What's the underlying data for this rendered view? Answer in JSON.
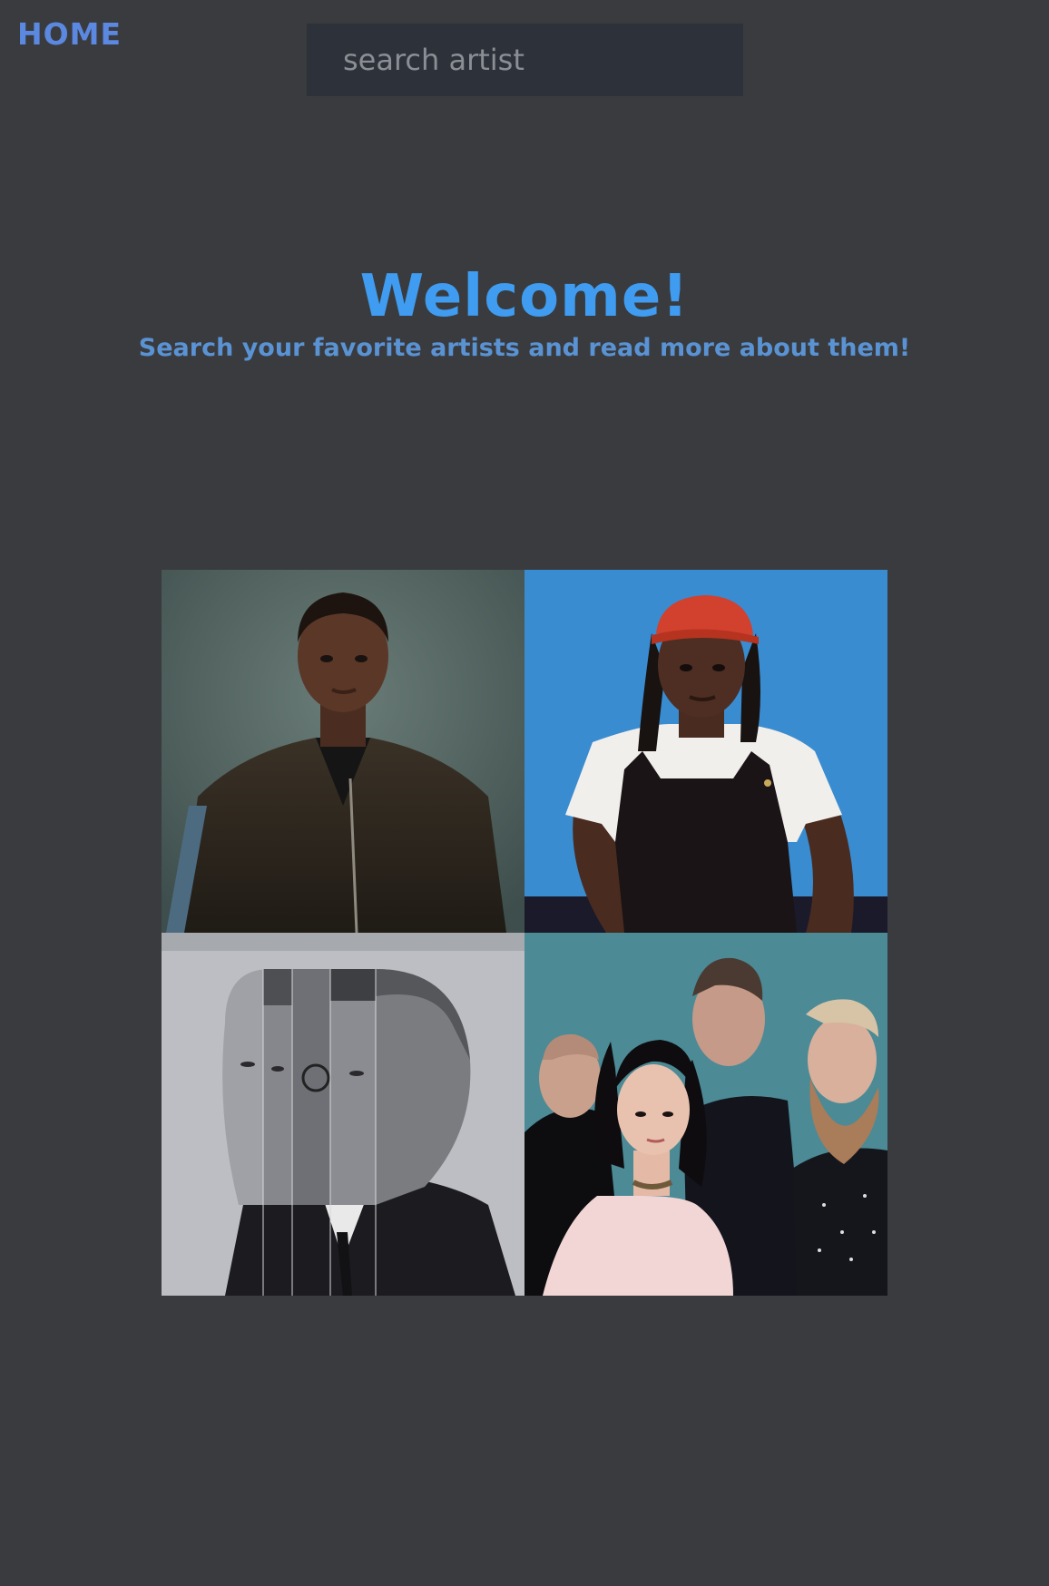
{
  "nav": {
    "home_label": "HOME"
  },
  "search": {
    "placeholder": "search artist",
    "value": ""
  },
  "hero": {
    "title": "Welcome!",
    "subtitle": "Search your favorite artists and read more about them!"
  },
  "colors": {
    "background": "#3a3b3e",
    "home": "#5b88e0",
    "title": "#3f9cf0",
    "subtitle": "#5a93d4",
    "search_bg": "#2d3139"
  },
  "gallery": {
    "tiles": [
      {
        "icon": "artist-photo",
        "scene": "man in dark leather jacket on green-grey backdrop"
      },
      {
        "icon": "artist-photo",
        "scene": "man in red cap and overalls on blue backdrop"
      },
      {
        "icon": "artist-photo",
        "scene": "black and white sliced face collage"
      },
      {
        "icon": "artist-photo",
        "scene": "four band members on teal backdrop"
      }
    ]
  }
}
